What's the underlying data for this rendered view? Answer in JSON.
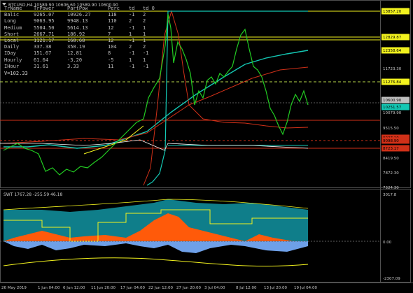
{
  "chart_header": {
    "icon": "down-triangle-icon",
    "text": "BTCUSD,H4  10589.90 10606.60 10589.90 10600.90"
  },
  "stats": {
    "headers": [
      "TrName",
      "TrPower",
      "PartPow",
      "Perc",
      "td",
      "td_0"
    ],
    "rows": [
      [
        "Balic",
        "9265.07",
        "10926.27",
        "118",
        "-1",
        "2"
      ],
      [
        "Long",
        "9063.95",
        "9948.13",
        "110",
        "2",
        "2"
      ],
      [
        "Medium",
        "5504.50",
        "5614.13",
        "12",
        "-1",
        "1"
      ],
      [
        "Short",
        "2667.71",
        "186.92",
        "7",
        "1",
        "1"
      ],
      [
        "Local",
        "1121.17",
        "168.68",
        "12",
        "-1",
        "1"
      ],
      [
        "Daily",
        "337.38",
        "350.19",
        "104",
        "2",
        "2"
      ],
      [
        "IDay",
        "151.67",
        "12.81",
        "8",
        "-1",
        "-1"
      ],
      [
        "Hourly",
        "61.64",
        "-3.20",
        "-5",
        "1",
        "1"
      ],
      [
        "IHour",
        "31.61",
        "3.33",
        "11",
        "-1",
        "-1"
      ]
    ],
    "vr_label": "V=102.33"
  },
  "price_axis": {
    "labels": [
      "13857.20",
      "12829.87",
      "12358.64",
      "11723.30",
      "11276.84",
      "10600.90",
      "10251.57",
      "10079.90",
      "9515.50",
      "9227.10",
      "9098.90",
      "8723.17",
      "8419.50",
      "7872.30",
      "7324.30"
    ],
    "colors": {
      "current": "#c0c0c0",
      "level_hi": "#f2f21e",
      "level_mid": "#f2f21e",
      "red": "#d03018",
      "teal": "#14c8b4"
    }
  },
  "indicator": {
    "title": "SWT 1767.28 -255.59 46.18",
    "axis_labels": [
      "3017.8",
      "0.00",
      "-2307.09"
    ]
  },
  "time_axis": [
    "26 May 2019",
    "1 Jun 04:00",
    "6 Jun 12:00",
    "11 Jun 20:00",
    "17 Jun 04:00",
    "22 Jun 12:00",
    "27 Jun 20:00",
    "3 Jul 04:00",
    "8 Jul 12:00",
    "13 Jul 20:00",
    "19 Jul 04:00"
  ]
}
